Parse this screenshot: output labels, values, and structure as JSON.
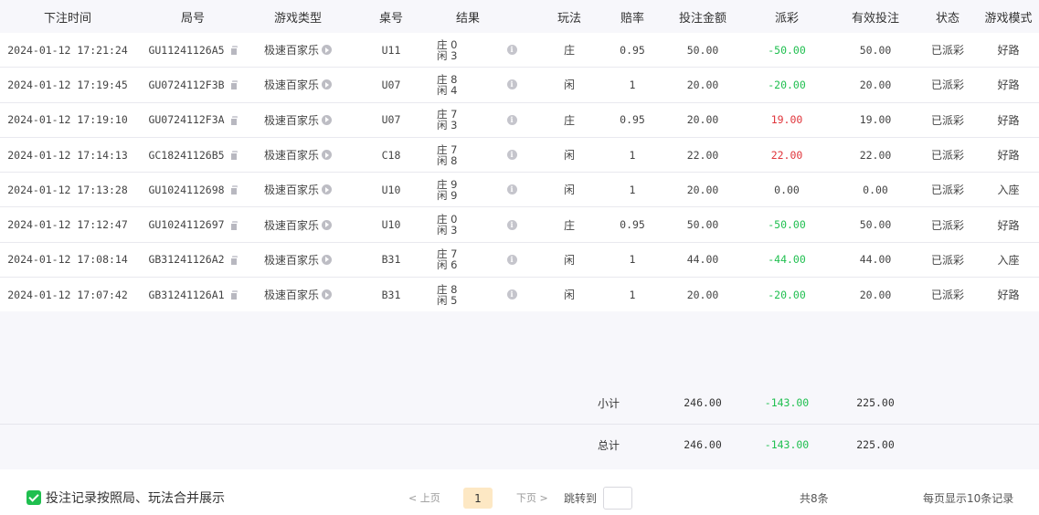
{
  "headers": {
    "bet_time": "下注时间",
    "round_no": "局号",
    "game_type": "游戏类型",
    "table_no": "桌号",
    "result": "结果",
    "play": "玩法",
    "odds": "赔率",
    "bet_amount": "投注金额",
    "payout": "派彩",
    "valid_bet": "有效投注",
    "status": "状态",
    "game_mode": "游戏模式"
  },
  "rows": [
    {
      "time": "2024-01-12 17:21:24",
      "round": "GU11241126A5",
      "game": "极速百家乐",
      "table": "U11",
      "banker": "庄 0",
      "player": "闲 3",
      "play": "庄",
      "odds": "0.95",
      "amount": "50.00",
      "payout": "-50.00",
      "payout_sign": "neg",
      "valid": "50.00",
      "status": "已派彩",
      "mode": "好路"
    },
    {
      "time": "2024-01-12 17:19:45",
      "round": "GU0724112F3B",
      "game": "极速百家乐",
      "table": "U07",
      "banker": "庄 8",
      "player": "闲 4",
      "play": "闲",
      "odds": "1",
      "amount": "20.00",
      "payout": "-20.00",
      "payout_sign": "neg",
      "valid": "20.00",
      "status": "已派彩",
      "mode": "好路"
    },
    {
      "time": "2024-01-12 17:19:10",
      "round": "GU0724112F3A",
      "game": "极速百家乐",
      "table": "U07",
      "banker": "庄 7",
      "player": "闲 3",
      "play": "庄",
      "odds": "0.95",
      "amount": "20.00",
      "payout": "19.00",
      "payout_sign": "pos",
      "valid": "19.00",
      "status": "已派彩",
      "mode": "好路"
    },
    {
      "time": "2024-01-12 17:14:13",
      "round": "GC18241126B5",
      "game": "极速百家乐",
      "table": "C18",
      "banker": "庄 7",
      "player": "闲 8",
      "play": "闲",
      "odds": "1",
      "amount": "22.00",
      "payout": "22.00",
      "payout_sign": "pos",
      "valid": "22.00",
      "status": "已派彩",
      "mode": "好路"
    },
    {
      "time": "2024-01-12 17:13:28",
      "round": "GU1024112698",
      "game": "极速百家乐",
      "table": "U10",
      "banker": "庄 9",
      "player": "闲 9",
      "play": "闲",
      "odds": "1",
      "amount": "20.00",
      "payout": "0.00",
      "payout_sign": "zero",
      "valid": "0.00",
      "status": "已派彩",
      "mode": "入座"
    },
    {
      "time": "2024-01-12 17:12:47",
      "round": "GU1024112697",
      "game": "极速百家乐",
      "table": "U10",
      "banker": "庄 0",
      "player": "闲 3",
      "play": "庄",
      "odds": "0.95",
      "amount": "50.00",
      "payout": "-50.00",
      "payout_sign": "neg",
      "valid": "50.00",
      "status": "已派彩",
      "mode": "好路"
    },
    {
      "time": "2024-01-12 17:08:14",
      "round": "GB31241126A2",
      "game": "极速百家乐",
      "table": "B31",
      "banker": "庄 7",
      "player": "闲 6",
      "play": "闲",
      "odds": "1",
      "amount": "44.00",
      "payout": "-44.00",
      "payout_sign": "neg",
      "valid": "44.00",
      "status": "已派彩",
      "mode": "入座"
    },
    {
      "time": "2024-01-12 17:07:42",
      "round": "GB31241126A1",
      "game": "极速百家乐",
      "table": "B31",
      "banker": "庄 8",
      "player": "闲 5",
      "play": "闲",
      "odds": "1",
      "amount": "20.00",
      "payout": "-20.00",
      "payout_sign": "neg",
      "valid": "20.00",
      "status": "已派彩",
      "mode": "好路"
    }
  ],
  "summary": {
    "subtotal_label": "小计",
    "subtotal_amount": "246.00",
    "subtotal_payout": "-143.00",
    "subtotal_valid": "225.00",
    "total_label": "总计",
    "total_amount": "246.00",
    "total_payout": "-143.00",
    "total_valid": "225.00"
  },
  "footer": {
    "merge_label": "投注记录按照局、玩法合并展示",
    "merge_checked": true,
    "prev_label": "< 上页",
    "current_page": "1",
    "next_label": "下页 >",
    "jump_label": "跳转到",
    "jump_value": "",
    "total_count": "共8条",
    "per_page": "每页显示10条记录"
  },
  "colors": {
    "negative": "#1fbf4f",
    "positive": "#e0353b",
    "header_bg": "#f7f7fb",
    "active_page_bg": "#fde8c4",
    "checkbox": "#1fbf4f"
  },
  "icons": {
    "copy": "copy-icon",
    "play": "play-circle-icon",
    "info": "info-icon",
    "check": "checkmark-icon"
  }
}
